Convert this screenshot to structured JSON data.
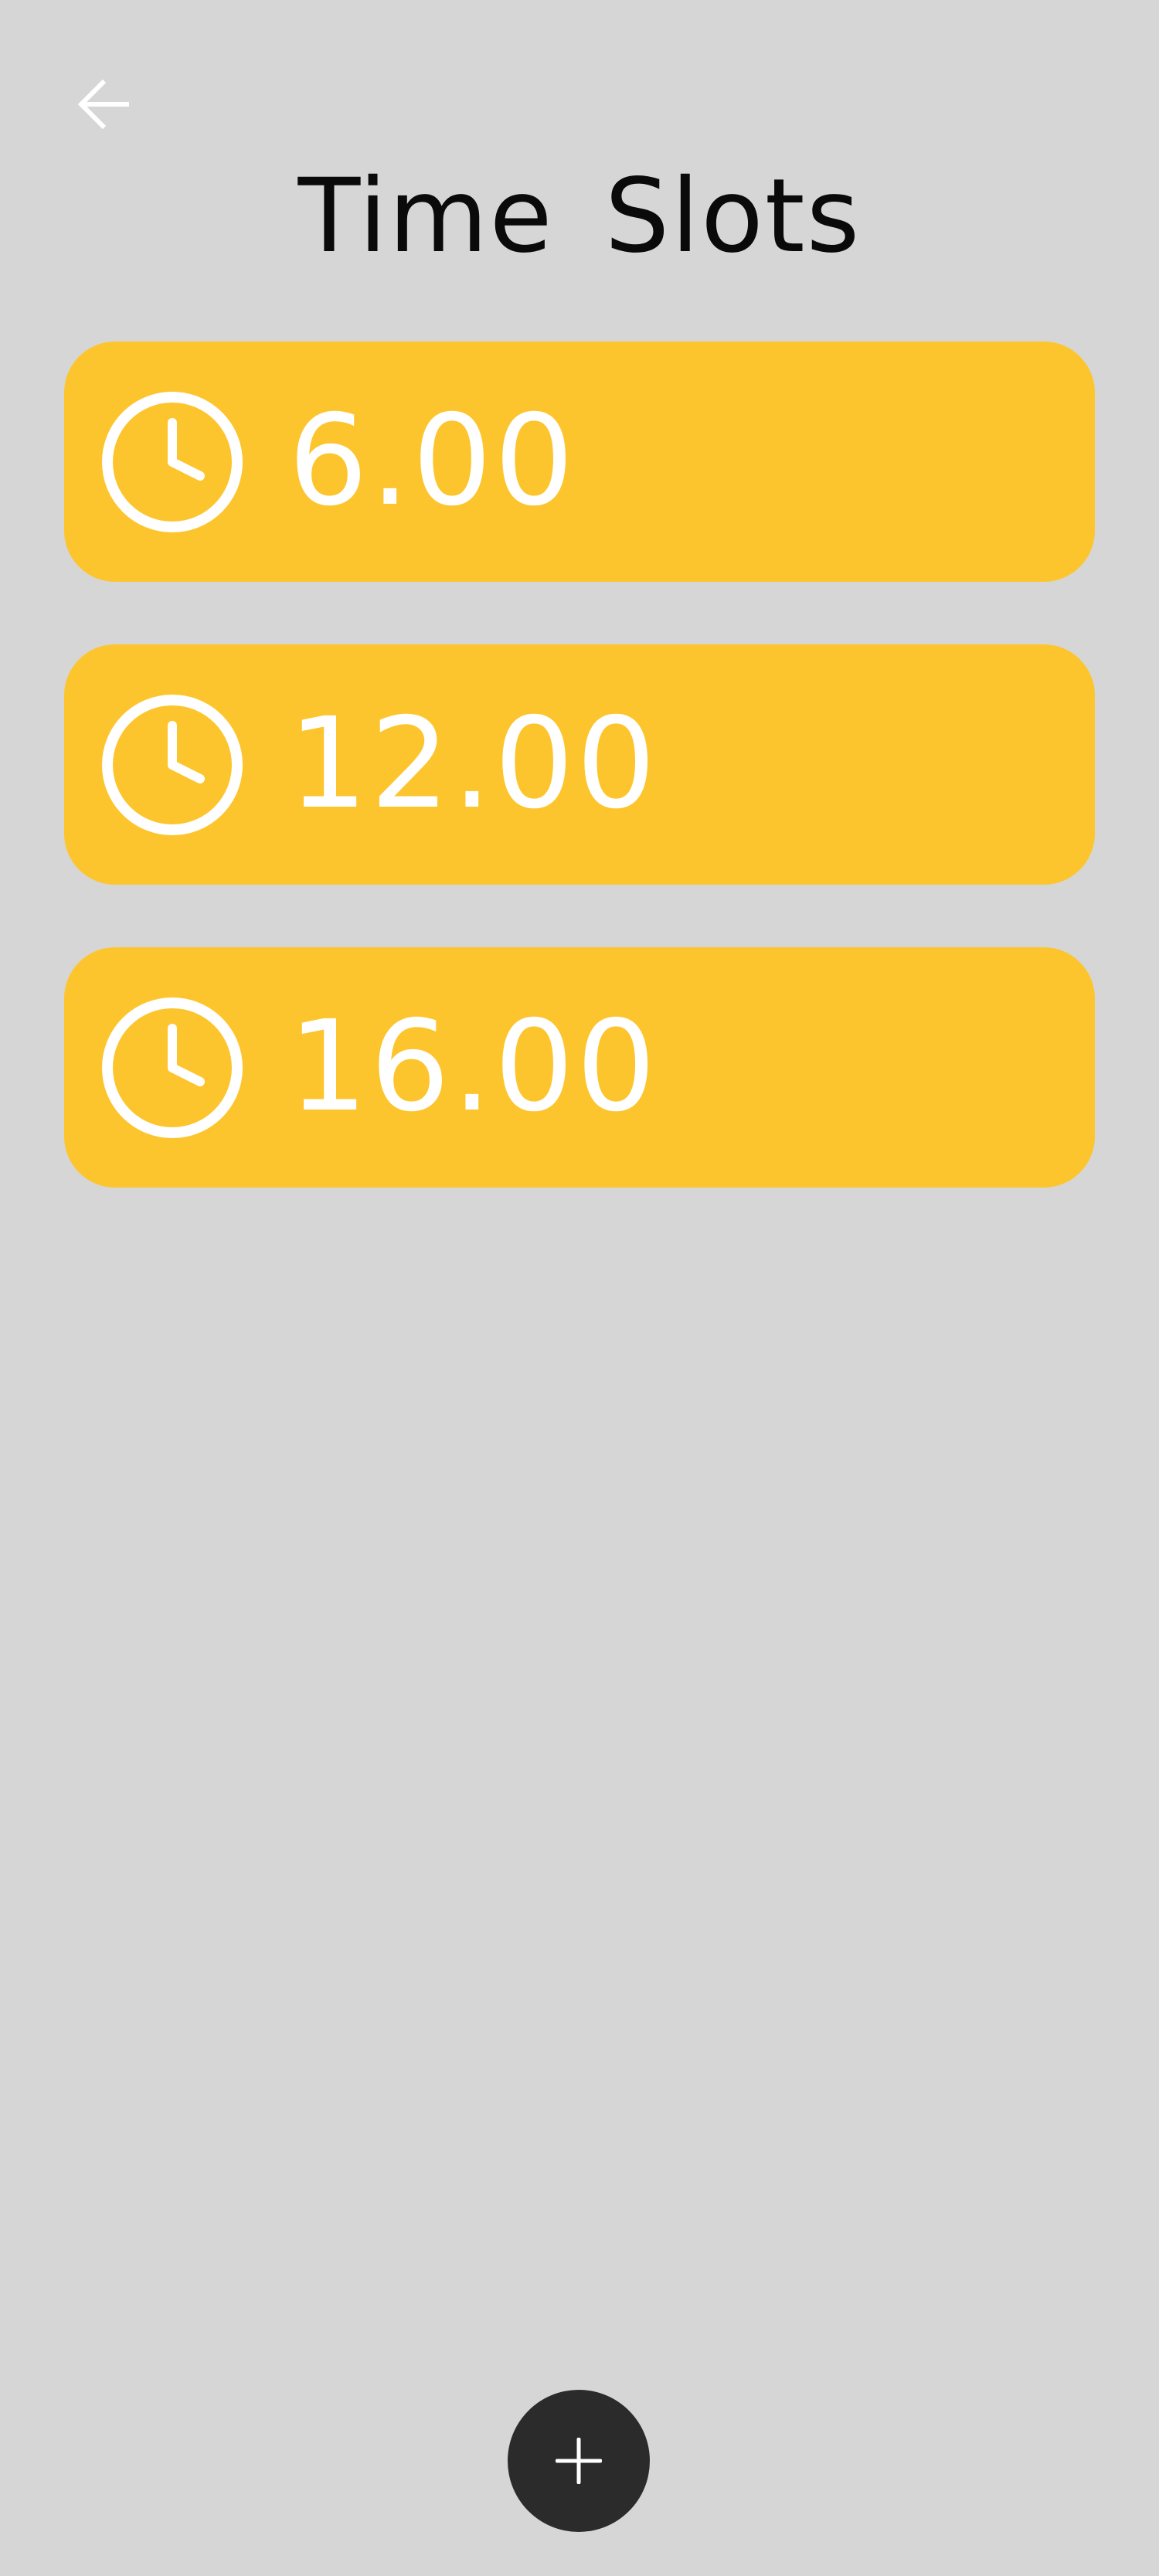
{
  "header": {
    "title": "Time  Slots",
    "back_icon": "arrow-left-icon"
  },
  "time_slots": [
    {
      "time": "6.00",
      "icon": "clock-icon"
    },
    {
      "time": "12.00",
      "icon": "clock-icon"
    },
    {
      "time": "16.00",
      "icon": "clock-icon"
    }
  ],
  "fab": {
    "icon": "plus-icon"
  },
  "colors": {
    "background": "#d6d6d6",
    "card": "#fdc52d",
    "card_text": "#ffffff",
    "title_text": "#0a0a0a",
    "fab": "#2b2b2b"
  }
}
